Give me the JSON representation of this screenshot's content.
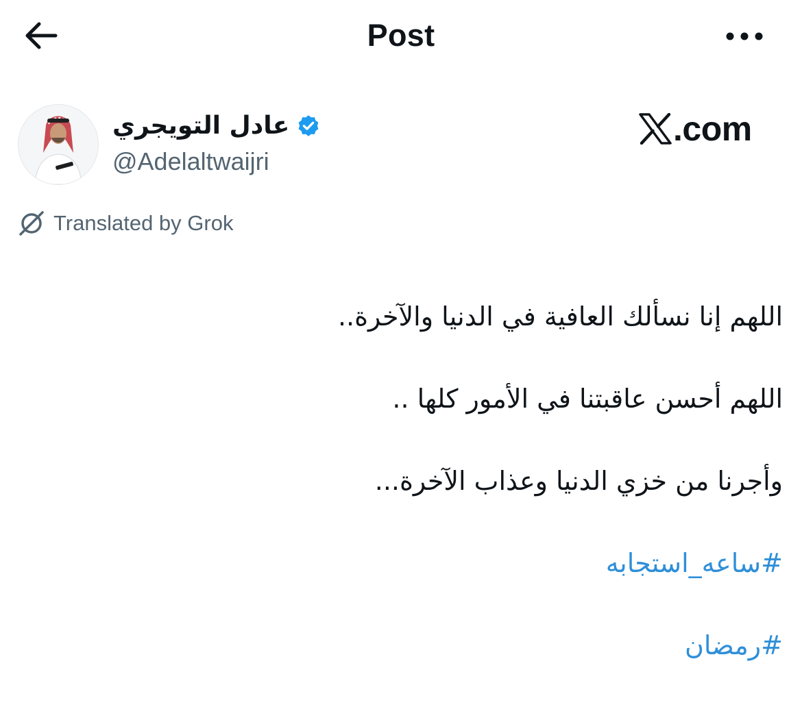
{
  "header": {
    "title": "Post",
    "back_icon": "arrow-left-icon",
    "more_icon": "more-horizontal-icon"
  },
  "author": {
    "display_name": "عادل التويجري",
    "handle": "@Adelaltwaijri",
    "verified": true,
    "verified_color": "#1d9bf0"
  },
  "brand": {
    "logo_icon": "x-logo-icon",
    "text": ".com"
  },
  "translation": {
    "label": "Translated by Grok",
    "icon": "grok-icon"
  },
  "post": {
    "lines": [
      "اللهم إنا نسألك  العافية في الدنيا والآخرة..",
      "اللهم أحسن عاقبتنا في الأمور كلها ..",
      "وأجرنا من خزي الدنيا وعذاب الآخرة..."
    ],
    "hashtags": [
      "#ساعه_استجابه",
      "#رمضان"
    ],
    "hashtag_color": "#2f8fd8"
  }
}
